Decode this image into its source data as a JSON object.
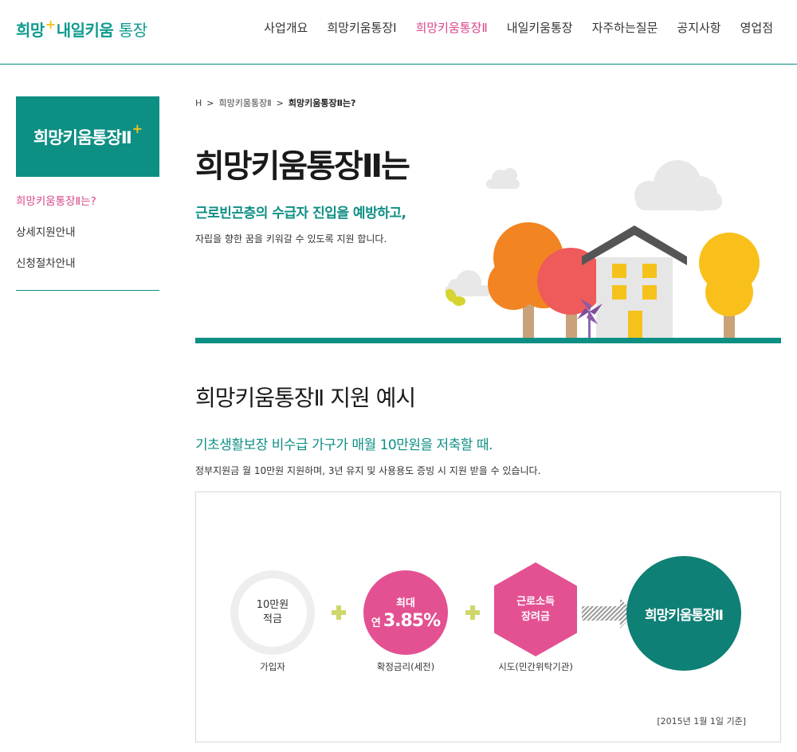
{
  "header": {
    "logo": {
      "part1": "희망",
      "plus": "+",
      "part2": "내일키움",
      "part3": "통장"
    },
    "nav": [
      {
        "label": "사업개요",
        "active": false
      },
      {
        "label": "희망키움통장Ⅰ",
        "active": false
      },
      {
        "label": "희망키움통장Ⅱ",
        "active": true
      },
      {
        "label": "내일키움통장",
        "active": false
      },
      {
        "label": "자주하는질문",
        "active": false
      },
      {
        "label": "공지사항",
        "active": false
      },
      {
        "label": "영업점",
        "active": false
      }
    ]
  },
  "sidebar": {
    "title": "희망키움통장Ⅱ",
    "title_plus": "+",
    "items": [
      {
        "label": "희망키움통장Ⅱ는?",
        "active": true
      },
      {
        "label": "상세지원안내",
        "active": false
      },
      {
        "label": "신청절차안내",
        "active": false
      }
    ]
  },
  "breadcrumb": {
    "home": "H",
    "sep": ">",
    "level1": "희망키움통장Ⅱ",
    "current": "희망키움통장Ⅱ는?"
  },
  "intro": {
    "title": "희망키움통장Ⅱ는",
    "subtitle": "근로빈곤층의 수급자 진입을 예방하고,",
    "description": "자립을 향한 꿈을 키워갈 수 있도록 지원 합니다."
  },
  "example": {
    "title": "희망키움통장Ⅱ 지원 예시",
    "subtitle": "기초생활보장 비수급 가구가 매월 10만원을 저축할 때.",
    "description": "정부지원금 월 10만원 지원하며, 3년 유지 및 사용용도 증빙 시 지원 받을 수 있습니다.",
    "diagram": {
      "savings": {
        "line1": "10만원",
        "line2": "적금",
        "caption": "가입자"
      },
      "interest": {
        "line1": "최대",
        "prefix": "연",
        "rate": "3.85%",
        "caption": "확정금리(세전)"
      },
      "incentive": {
        "line1": "근로소득",
        "line2": "장려금",
        "caption": "시도(민간위탁기관)"
      },
      "result": "희망키움통장Ⅱ",
      "footnote": "[2015년 1월 1일 기준]"
    }
  },
  "colors": {
    "teal": "#0e8f84",
    "pink": "#e35192",
    "yellow": "#f2c21b",
    "plus_sign": "#cfd76b"
  }
}
